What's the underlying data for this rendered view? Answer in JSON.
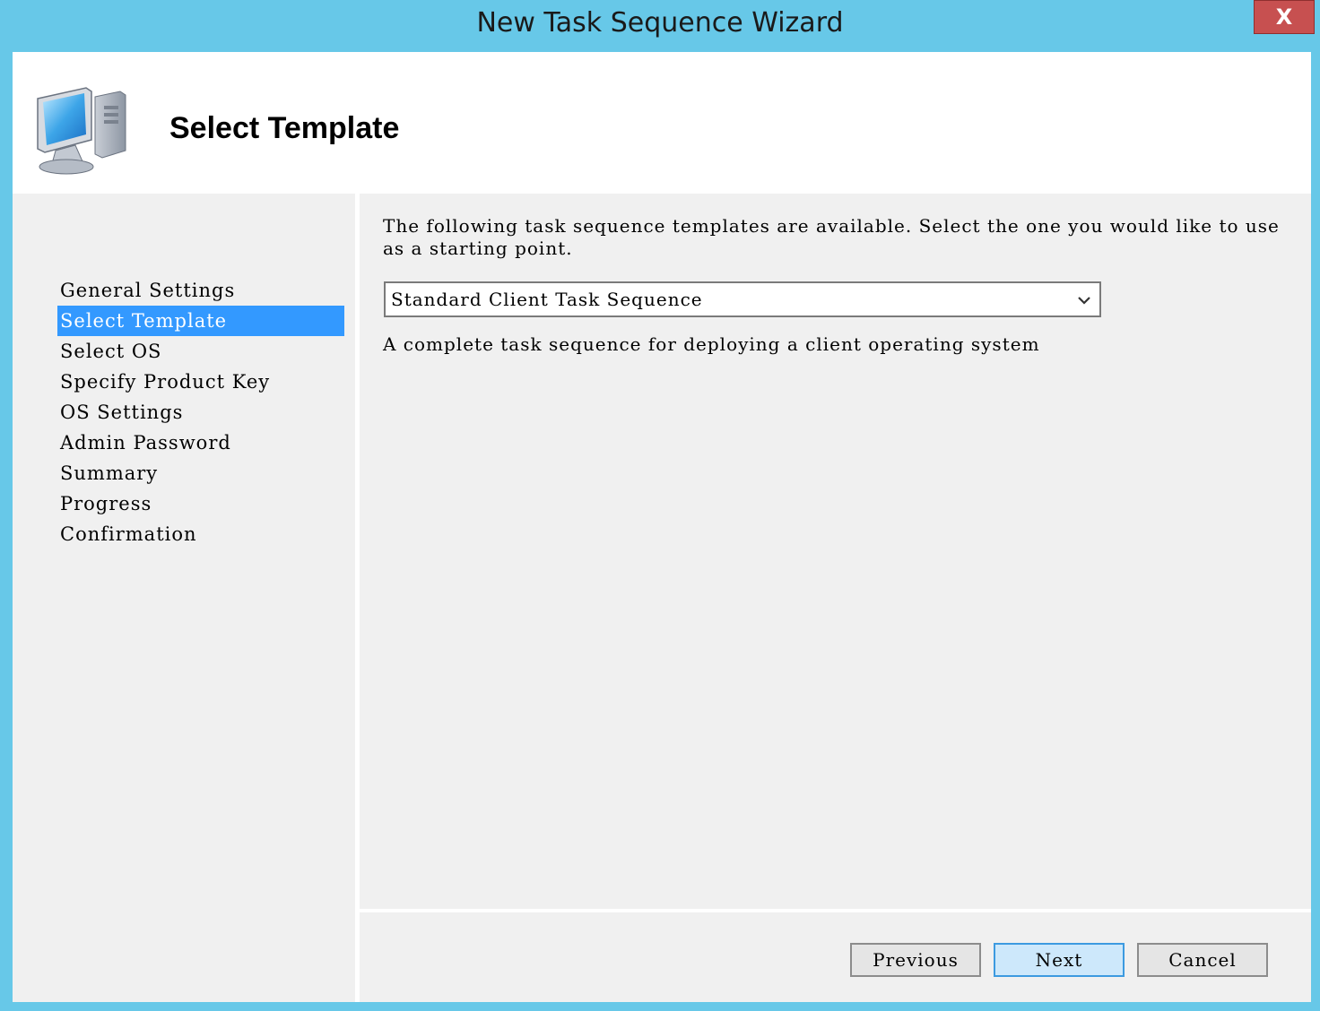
{
  "window": {
    "title": "New Task Sequence Wizard",
    "close_label": "X"
  },
  "header": {
    "icon": "computer-icon",
    "title": "Select Template"
  },
  "sidebar": {
    "items": [
      {
        "label": "General Settings",
        "selected": false
      },
      {
        "label": "Select Template",
        "selected": true
      },
      {
        "label": "Select OS",
        "selected": false
      },
      {
        "label": "Specify Product Key",
        "selected": false
      },
      {
        "label": "OS Settings",
        "selected": false
      },
      {
        "label": "Admin Password",
        "selected": false
      },
      {
        "label": "Summary",
        "selected": false
      },
      {
        "label": "Progress",
        "selected": false
      },
      {
        "label": "Confirmation",
        "selected": false
      }
    ]
  },
  "main": {
    "intro": "The following task sequence templates are available.  Select the one you would like to use as a starting point.",
    "template_select": {
      "selected": "Standard Client Task Sequence",
      "icon": "chevron-down-icon"
    },
    "description": "A complete task sequence for deploying a client operating system"
  },
  "footer": {
    "previous_label": "Previous",
    "next_label": "Next",
    "cancel_label": "Cancel"
  },
  "colors": {
    "titlebar": "#67c8e8",
    "selection": "#3399ff",
    "close": "#c75050",
    "default_button": "#cde8fb"
  }
}
